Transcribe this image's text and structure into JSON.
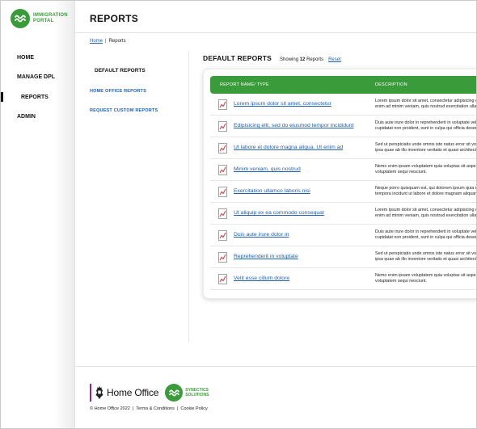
{
  "brand": {
    "line1": "IMMIGRATION",
    "line2": "PORTAL",
    "accent": "#3a9b3a"
  },
  "nav": [
    {
      "label": "HOME"
    },
    {
      "label": "MANAGE DPL"
    },
    {
      "label": "REPORTS"
    },
    {
      "label": "ADMIN"
    }
  ],
  "page": {
    "title": "REPORTS"
  },
  "breadcrumb": {
    "home": "Home",
    "sep": "|",
    "current": "Reports"
  },
  "submenu": {
    "heading": "DEFAULT REPORTS",
    "link1": "HOME OFFICE REPORTS",
    "link2": "REQUEST CUSTOM REPORTS"
  },
  "section": {
    "title": "DEFAULT REPORTS",
    "showing_prefix": "Showing",
    "count": "12",
    "showing_suffix": "Reports",
    "reset": "Reset"
  },
  "table": {
    "columns": [
      "REPORT NAME/ TYPE",
      "DESCRIPTION"
    ],
    "rows": [
      {
        "name": "Lorem ipsum dolor sit amet, consectetur",
        "desc1": "Lorem ipsum dolor sit amet, consectetur adipisicing elit, sed do",
        "desc2": "enim ad minim veniam, quis nostrud exercitation ullamco"
      },
      {
        "name": "Edipisicing elit, sed do eiusmod tempor incididunt",
        "desc1": "Duis aute irure dolor in reprehenderit in voluptate velit esse",
        "desc2": "cupidatat non proident, sunt in culpa qui officia deserunt"
      },
      {
        "name": "Ut labore et dolore magna aliqua. Ut enim ad",
        "desc1": "Sed ut perspiciatis unde omnis iste natus error sit voluptatem",
        "desc2": "ipsa quae ab illo inventore veritatis et quasi architecto"
      },
      {
        "name": "Minim veniam, quis nostrud",
        "desc1": "Nemo enim ipsam voluptatem quia voluptas sit aspernatur aut",
        "desc2": "voluptatem sequi nesciunt."
      },
      {
        "name": "Exercitation ullamco laboris nisi",
        "desc1": "Neque porro quisquam est, qui dolorem ipsum quia dolor sit",
        "desc2": "tempora incidunt ut labore et dolore magnam aliquam"
      },
      {
        "name": "Ut aliquip ex ea commodo consequat",
        "desc1": "Lorem ipsum dolor sit amet, consectetur adipisicing elit, sed do",
        "desc2": "enim ad minim veniam, quis nostrud exercitation ullamco"
      },
      {
        "name": "Duis aute irure dolor in",
        "desc1": "Duis aute irure dolor in reprehenderit in voluptate velit esse",
        "desc2": "cupidatat non proident, sunt in culpa qui officia deserunt"
      },
      {
        "name": "Reprehenderit in voluptate",
        "desc1": "Sed ut perspiciatis unde omnis iste natus error sit voluptatem",
        "desc2": "ipsa quae ab illo inventore veritatis et quasi architecto"
      },
      {
        "name": "Velit esse cillum dolore",
        "desc1": "Nemo enim ipsam voluptatem quia voluptas sit aspernatur aut",
        "desc2": "voluptatem sequi nesciunt."
      }
    ],
    "header_color": "#3a9b3a",
    "row_icon": "report-chart-icon"
  },
  "footer": {
    "home_office": "Home Office",
    "synectics_line1": "SYNECTICS",
    "synectics_line2": "SOLUTIONS",
    "copyright": "© Home Office 2022",
    "terms": "Terms & Conditions",
    "cookie": "Cookie Policy",
    "sep": "|"
  }
}
